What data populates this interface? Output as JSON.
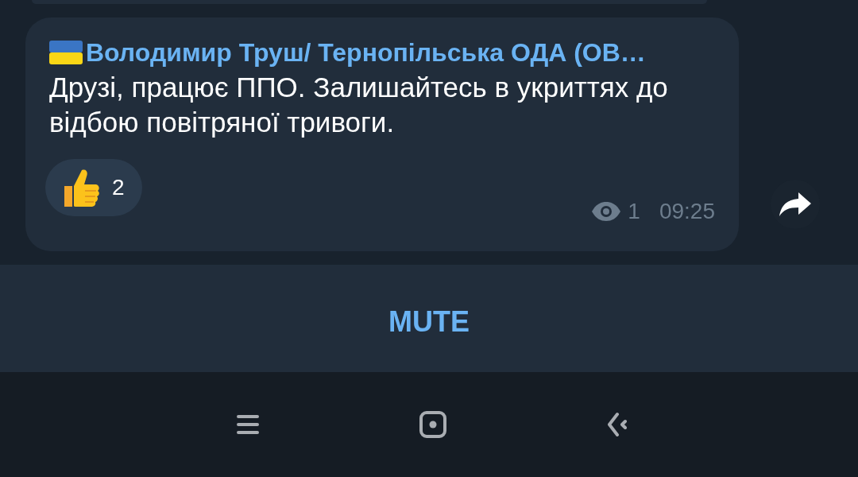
{
  "message": {
    "channel_name": "Володимир Труш/ Тернопільська ОДА (ОВ…",
    "text": "Друзі, працює ППО. Залишайтесь в укриттях до відбою повітряної тривоги.",
    "reactions": [
      {
        "count": "2"
      }
    ],
    "views": "1",
    "time": "09:25"
  },
  "bottom_bar": {
    "button": "MUTE"
  }
}
